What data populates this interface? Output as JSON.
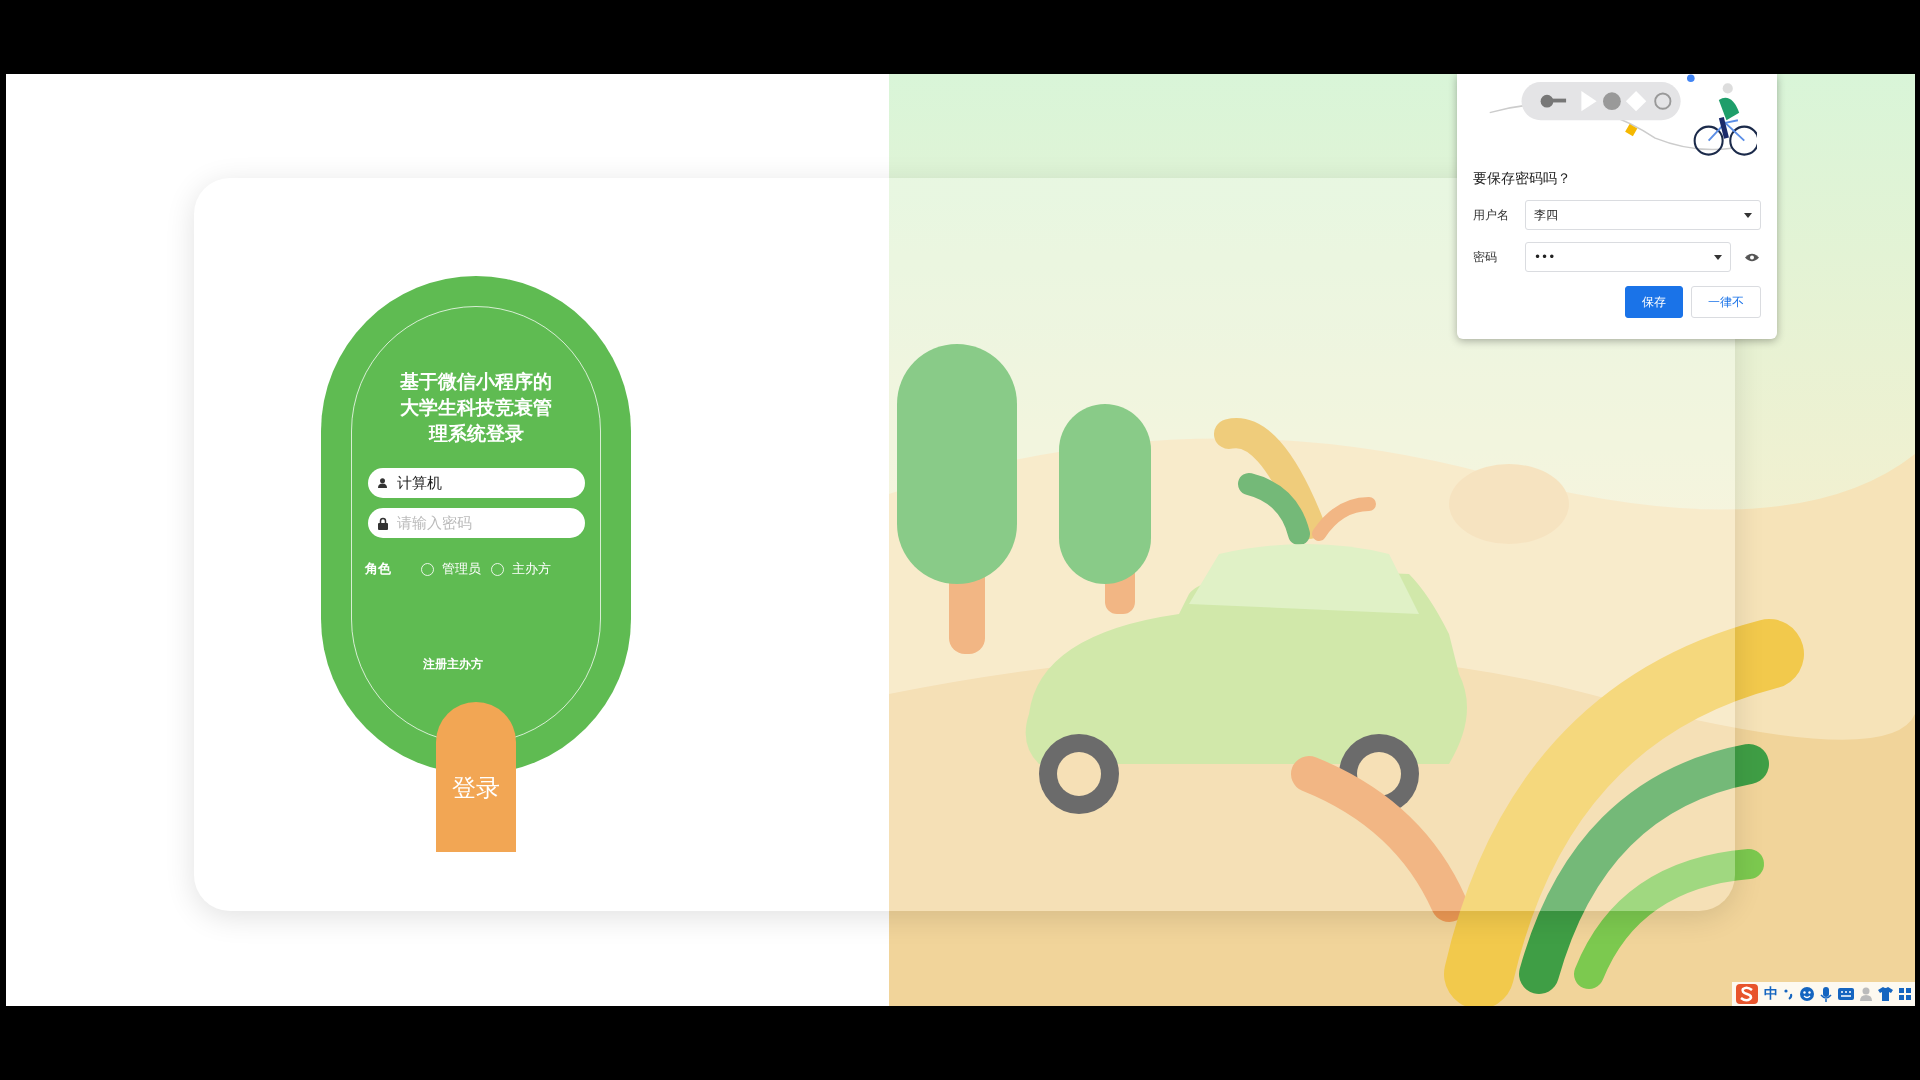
{
  "login": {
    "title": "基于微信小程序的大学生科技竞衰管理系统登录",
    "username": {
      "value": "计算机"
    },
    "password": {
      "placeholder": "请输入密码"
    },
    "role_label": "角色",
    "roles": [
      {
        "label": "管理员",
        "selected": false
      },
      {
        "label": "主办方",
        "selected": false
      }
    ],
    "register_link": "注册主办方",
    "login_button": "登录"
  },
  "save_password_dialog": {
    "title": "要保存密码吗？",
    "username_label": "用户名",
    "username_value": "李四",
    "password_label": "密码",
    "password_value": "•••",
    "buttons": [
      {
        "label": "保存",
        "kind": "primary"
      },
      {
        "label": "一律不",
        "kind": "secondary"
      }
    ]
  },
  "ime_toolbar": {
    "mode": "中"
  }
}
